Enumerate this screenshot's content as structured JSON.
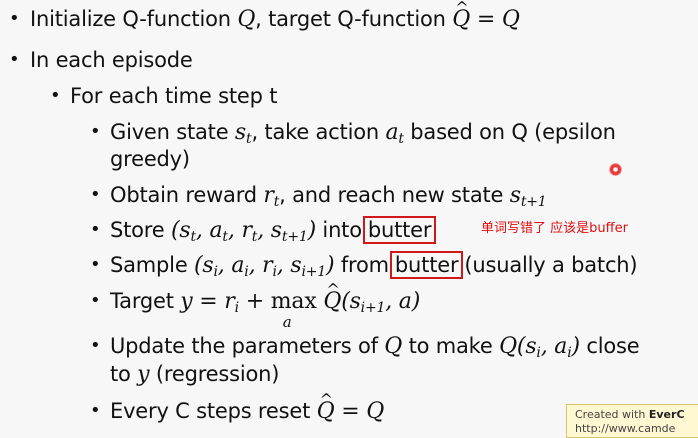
{
  "slide": {
    "bullets": {
      "init": {
        "text_a": "Initialize Q-function ",
        "text_b": ", target Q-function "
      },
      "episode": {
        "text": "In each episode"
      },
      "timestep": {
        "text": "For each time step t"
      },
      "given": {
        "text_a": "Given state ",
        "text_b": ", take action ",
        "text_c": " based on Q (epsilon",
        "text_d": "greedy)"
      },
      "obtain": {
        "text_a": "Obtain reward ",
        "text_b": ", and reach new state "
      },
      "store": {
        "text_a": "Store ",
        "text_b": " into",
        "boxed": "butter"
      },
      "sample": {
        "text_a": "Sample ",
        "text_b": " from",
        "boxed": "butter",
        "text_c": "(usually a batch)"
      },
      "target": {
        "text_a": "Target "
      },
      "update": {
        "text_a": "Update the parameters of ",
        "text_b": " to make ",
        "text_c": " close",
        "text_d": "to ",
        "text_e": " (regression)"
      },
      "every": {
        "text_a": "Every C steps reset "
      }
    },
    "annotation": "单词写错了 应该是buffer",
    "watermark": {
      "line1_prefix": "Created with ",
      "line1_brand": "EverC",
      "line2": "http://www.camde"
    }
  },
  "colors": {
    "annotation": "#e01010",
    "box_border": "#d01818",
    "background": "#f7f7f7"
  }
}
